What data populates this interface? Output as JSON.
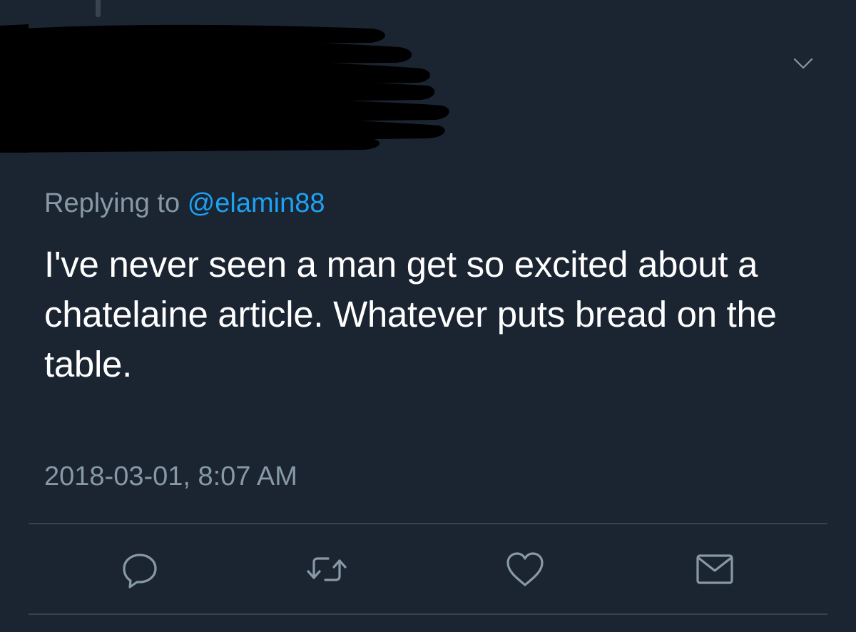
{
  "tweet": {
    "replying_prefix": "Replying to",
    "replying_handle": "@elamin88",
    "text": "I've never seen a man get so excited about a chatelaine article. Whatever puts bread on the table.",
    "timestamp": "2018-03-01, 8:07 AM"
  },
  "icons": {
    "menu": "chevron-down-icon",
    "reply": "reply-icon",
    "retweet": "retweet-icon",
    "like": "heart-icon",
    "share": "envelope-icon"
  },
  "colors": {
    "background": "#1b2431",
    "text": "#ffffff",
    "secondary_text": "#8899a6",
    "link": "#1da1f2",
    "divider": "#38444d",
    "redaction": "#000000"
  }
}
